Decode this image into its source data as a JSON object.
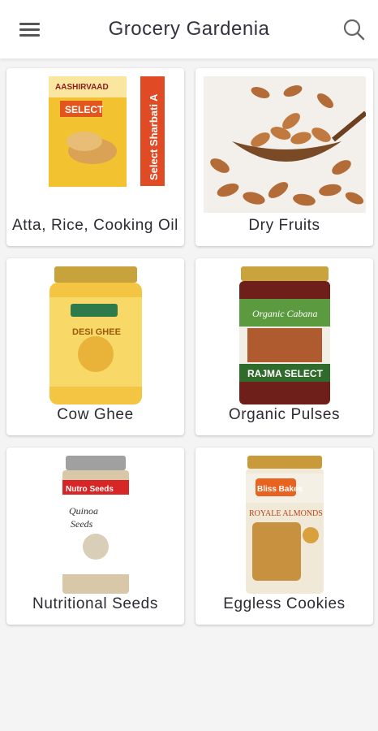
{
  "header": {
    "title": "Grocery Gardenia",
    "menu_icon": "hamburger-menu-icon",
    "search_icon": "search-icon"
  },
  "categories": [
    {
      "label": "Atta, Rice, Cooking Oil",
      "image": "atta-package-image",
      "image_text": "AASHIRVAAD SELECT",
      "side_text": "Select Sharbati A"
    },
    {
      "label": "Dry Fruits",
      "image": "almonds-image",
      "image_text": ""
    },
    {
      "label": "Cow Ghee",
      "image": "ghee-jar-image",
      "image_text": "DESI GHEE"
    },
    {
      "label": "Organic Pulses",
      "image": "rajma-jar-image",
      "image_text": "RAJMA SELECT"
    },
    {
      "label": "Nutritional Seeds",
      "image": "quinoa-jar-image",
      "image_text": "Quinoa Seeds"
    },
    {
      "label": "Eggless Cookies",
      "image": "cookies-jar-image",
      "image_text": "ROYALE ALMONDS"
    }
  ],
  "colors": {
    "background": "#f4f4f4",
    "card": "#ffffff",
    "text": "#2b2b33"
  }
}
